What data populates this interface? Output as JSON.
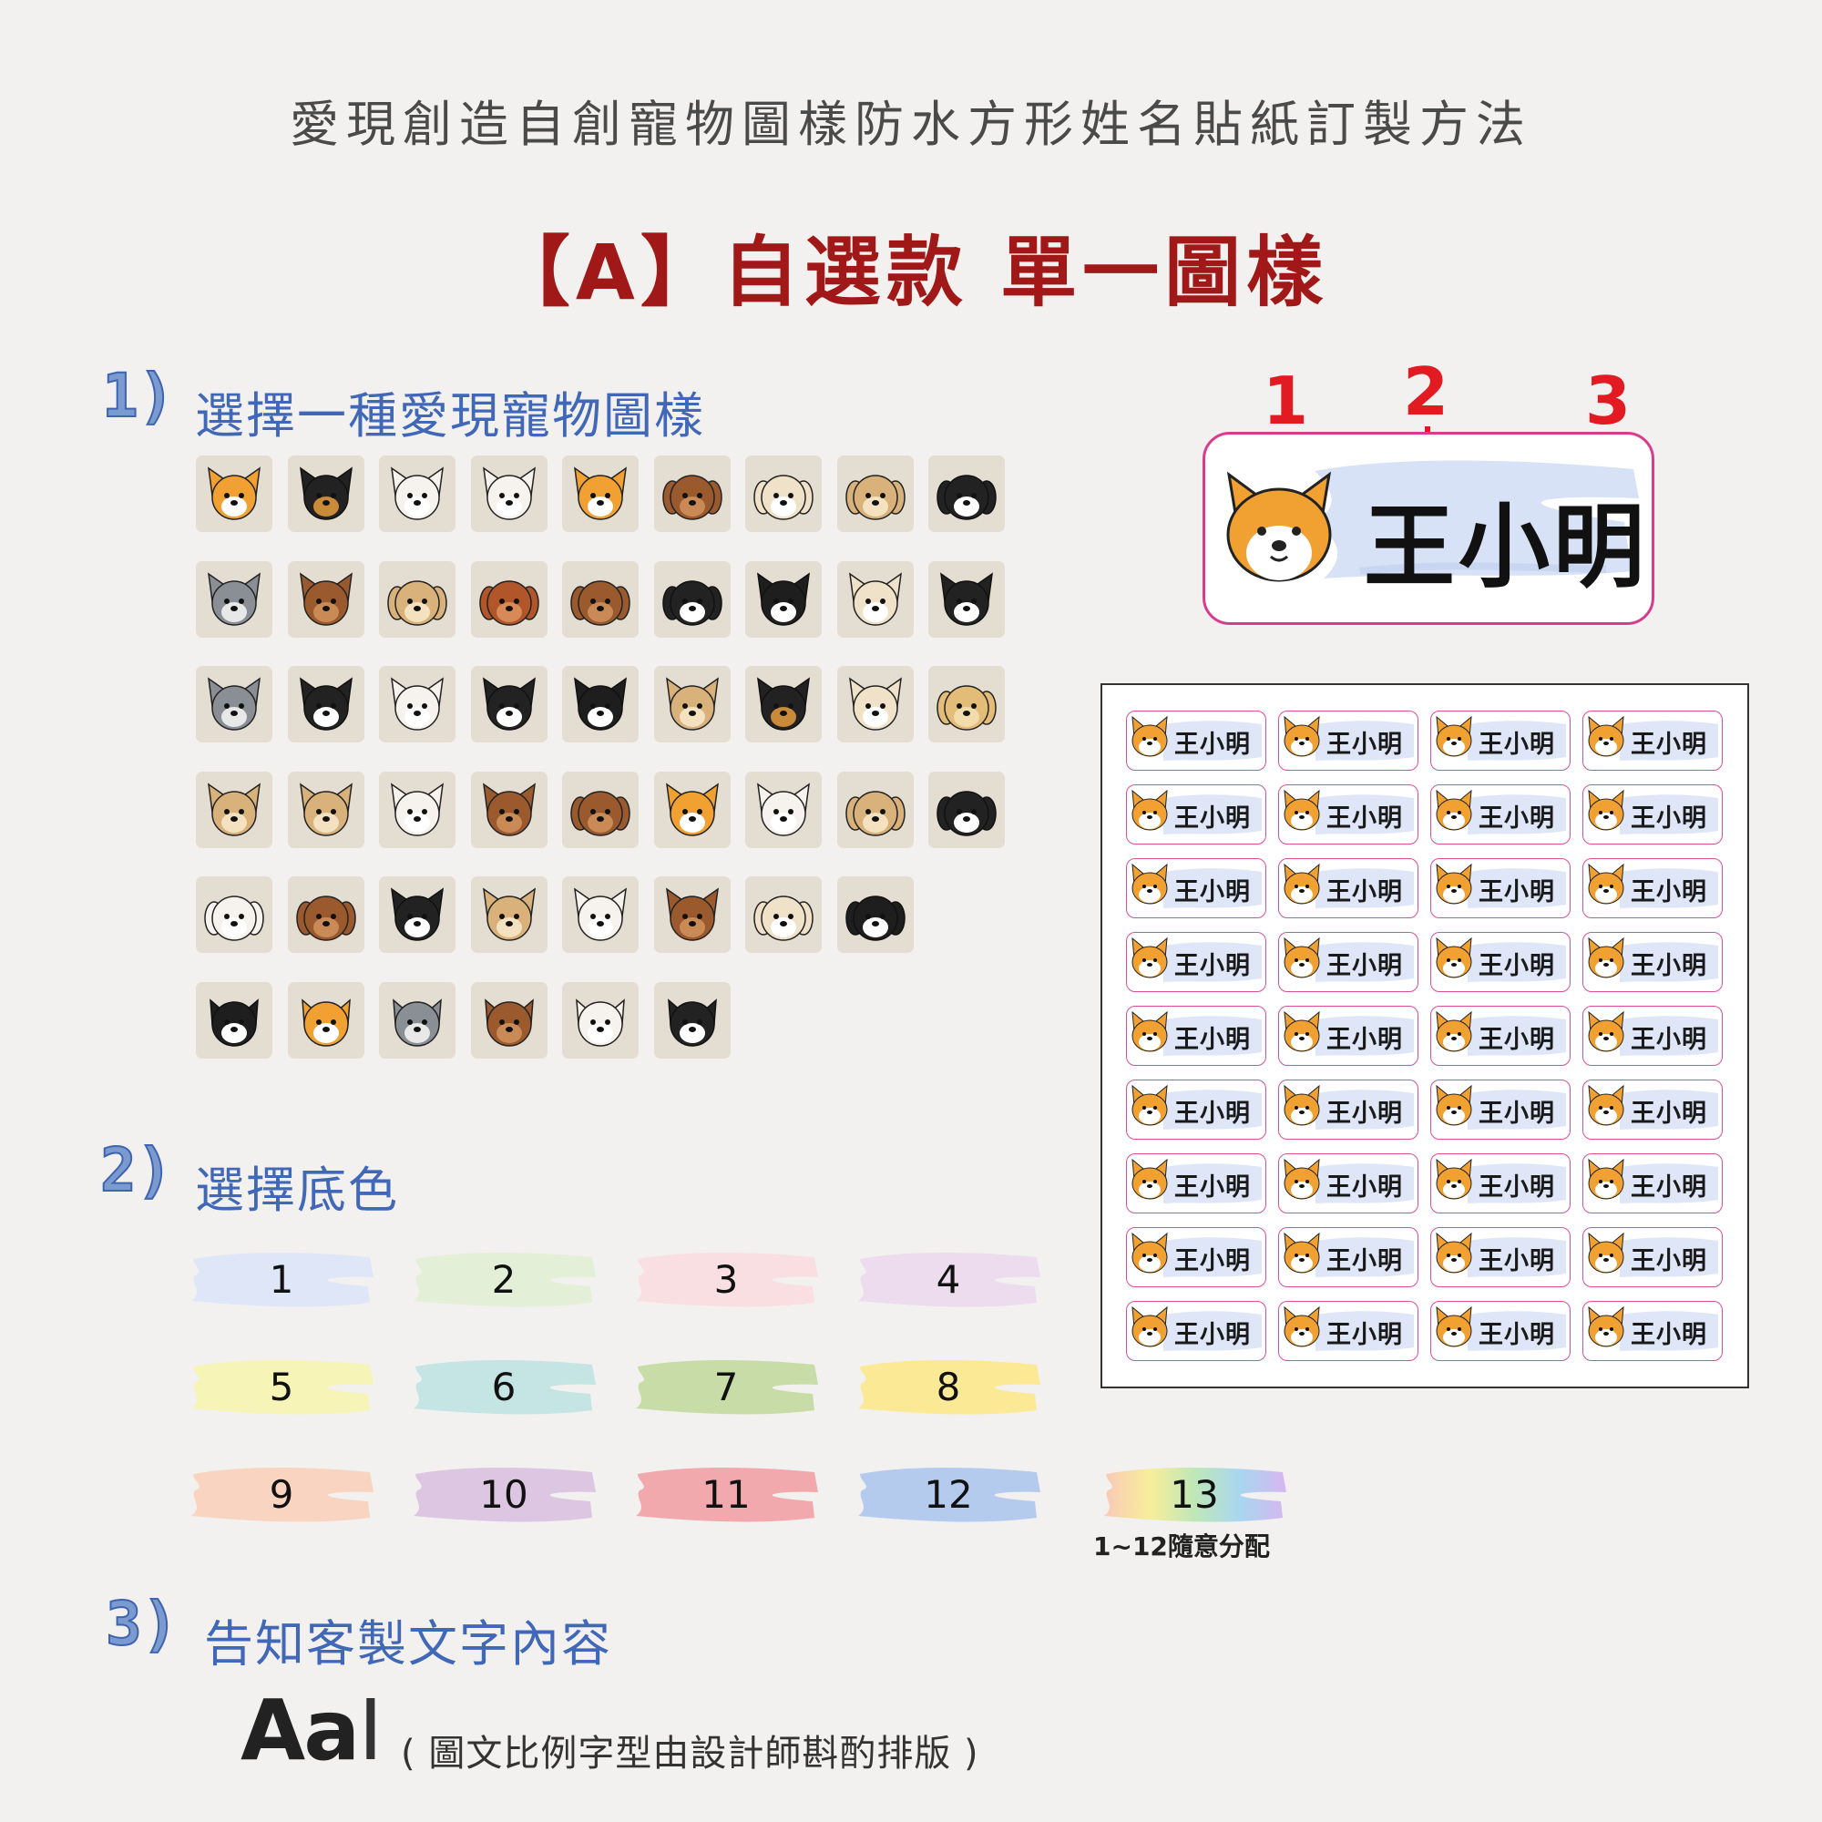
{
  "title": "愛現創造自創寵物圖樣防水方形姓名貼紙訂製方法",
  "subtitle": "【A】自選款 單一圖樣",
  "steps": [
    {
      "number": "1)",
      "label": "選擇一種愛現寵物圖樣"
    },
    {
      "number": "2)",
      "label": "選擇底色"
    },
    {
      "number": "3)",
      "label": "告知客製文字內容"
    }
  ],
  "pet_rows": [
    [
      "orange-dog-icon",
      "black-tan-dog-icon",
      "white-dog-icon",
      "white-fluffy-dog-icon",
      "corgi-dog-icon",
      "brown-poodle-icon",
      "cream-poodle-icon",
      "tan-poodle-icon",
      "black-poodle-icon"
    ],
    [
      "husky-grey-icon",
      "husky-brown-icon",
      "tan-spaniel-icon",
      "red-spaniel-icon",
      "brown-spaniel-icon",
      "black-dachshund-icon",
      "boston-terrier-icon",
      "cream-bulldog-icon",
      "black-bulldog-icon"
    ],
    [
      "grey-schnauzer-icon",
      "black-schnauzer-icon",
      "white-schnauzer-icon",
      "black-terrier-icon",
      "black-white-chihuahua-icon",
      "tan-chihuahua-icon",
      "black-tan-chihuahua-icon",
      "cream-chihuahua-icon",
      "golden-retriever-icon"
    ],
    [
      "longhair-chihuahua-icon",
      "tan-longhair-chihuahua-icon",
      "white-longhair-chihuahua-icon",
      "brown-longhair-chihuahua-icon",
      "yorkie-icon",
      "pomeranian-icon",
      "white-pomeranian-icon",
      "yellow-lab-icon",
      "black-lab-icon"
    ],
    [
      "bichon-icon",
      "beagle-icon",
      "black-formosan-dog-icon",
      "tan-formosan-dog-icon",
      "white-formosan-dog-icon",
      "brindle-formosan-dog-icon",
      "shih-tzu-icon",
      "black-white-shih-tzu-icon"
    ],
    [
      "tuxedo-cat-icon",
      "orange-tabby-cat-icon",
      "silver-tabby-cat-icon",
      "brown-tabby-cat-icon",
      "white-cat-icon",
      "black-cat-icon"
    ]
  ],
  "sample": {
    "name": "王小明",
    "callouts": [
      "1",
      "2",
      "3"
    ],
    "bg_color": "#d8e2f6",
    "border_color": "#d83c8c"
  },
  "sheet": {
    "rows": 9,
    "cols": 4,
    "name": "王小明"
  },
  "swatches": [
    {
      "num": "1",
      "color": "#dfe6f8"
    },
    {
      "num": "2",
      "color": "#e3efd6"
    },
    {
      "num": "3",
      "color": "#f9dfe2"
    },
    {
      "num": "4",
      "color": "#ecdcee"
    },
    {
      "num": "5",
      "color": "#f6f4b6"
    },
    {
      "num": "6",
      "color": "#c5e4e4"
    },
    {
      "num": "7",
      "color": "#c8dca8"
    },
    {
      "num": "8",
      "color": "#fbe996"
    },
    {
      "num": "9",
      "color": "#f9d4c0"
    },
    {
      "num": "10",
      "color": "#ddc6e2"
    },
    {
      "num": "11",
      "color": "#f1a9ae"
    },
    {
      "num": "12",
      "color": "#b5cbee"
    },
    {
      "num": "13",
      "color": "rainbow"
    }
  ],
  "rainbow_note": "1~12隨意分配",
  "text_sample": {
    "glyph": "Aa",
    "note": "( 圖文比例字型由設計師斟酌排版 )"
  }
}
